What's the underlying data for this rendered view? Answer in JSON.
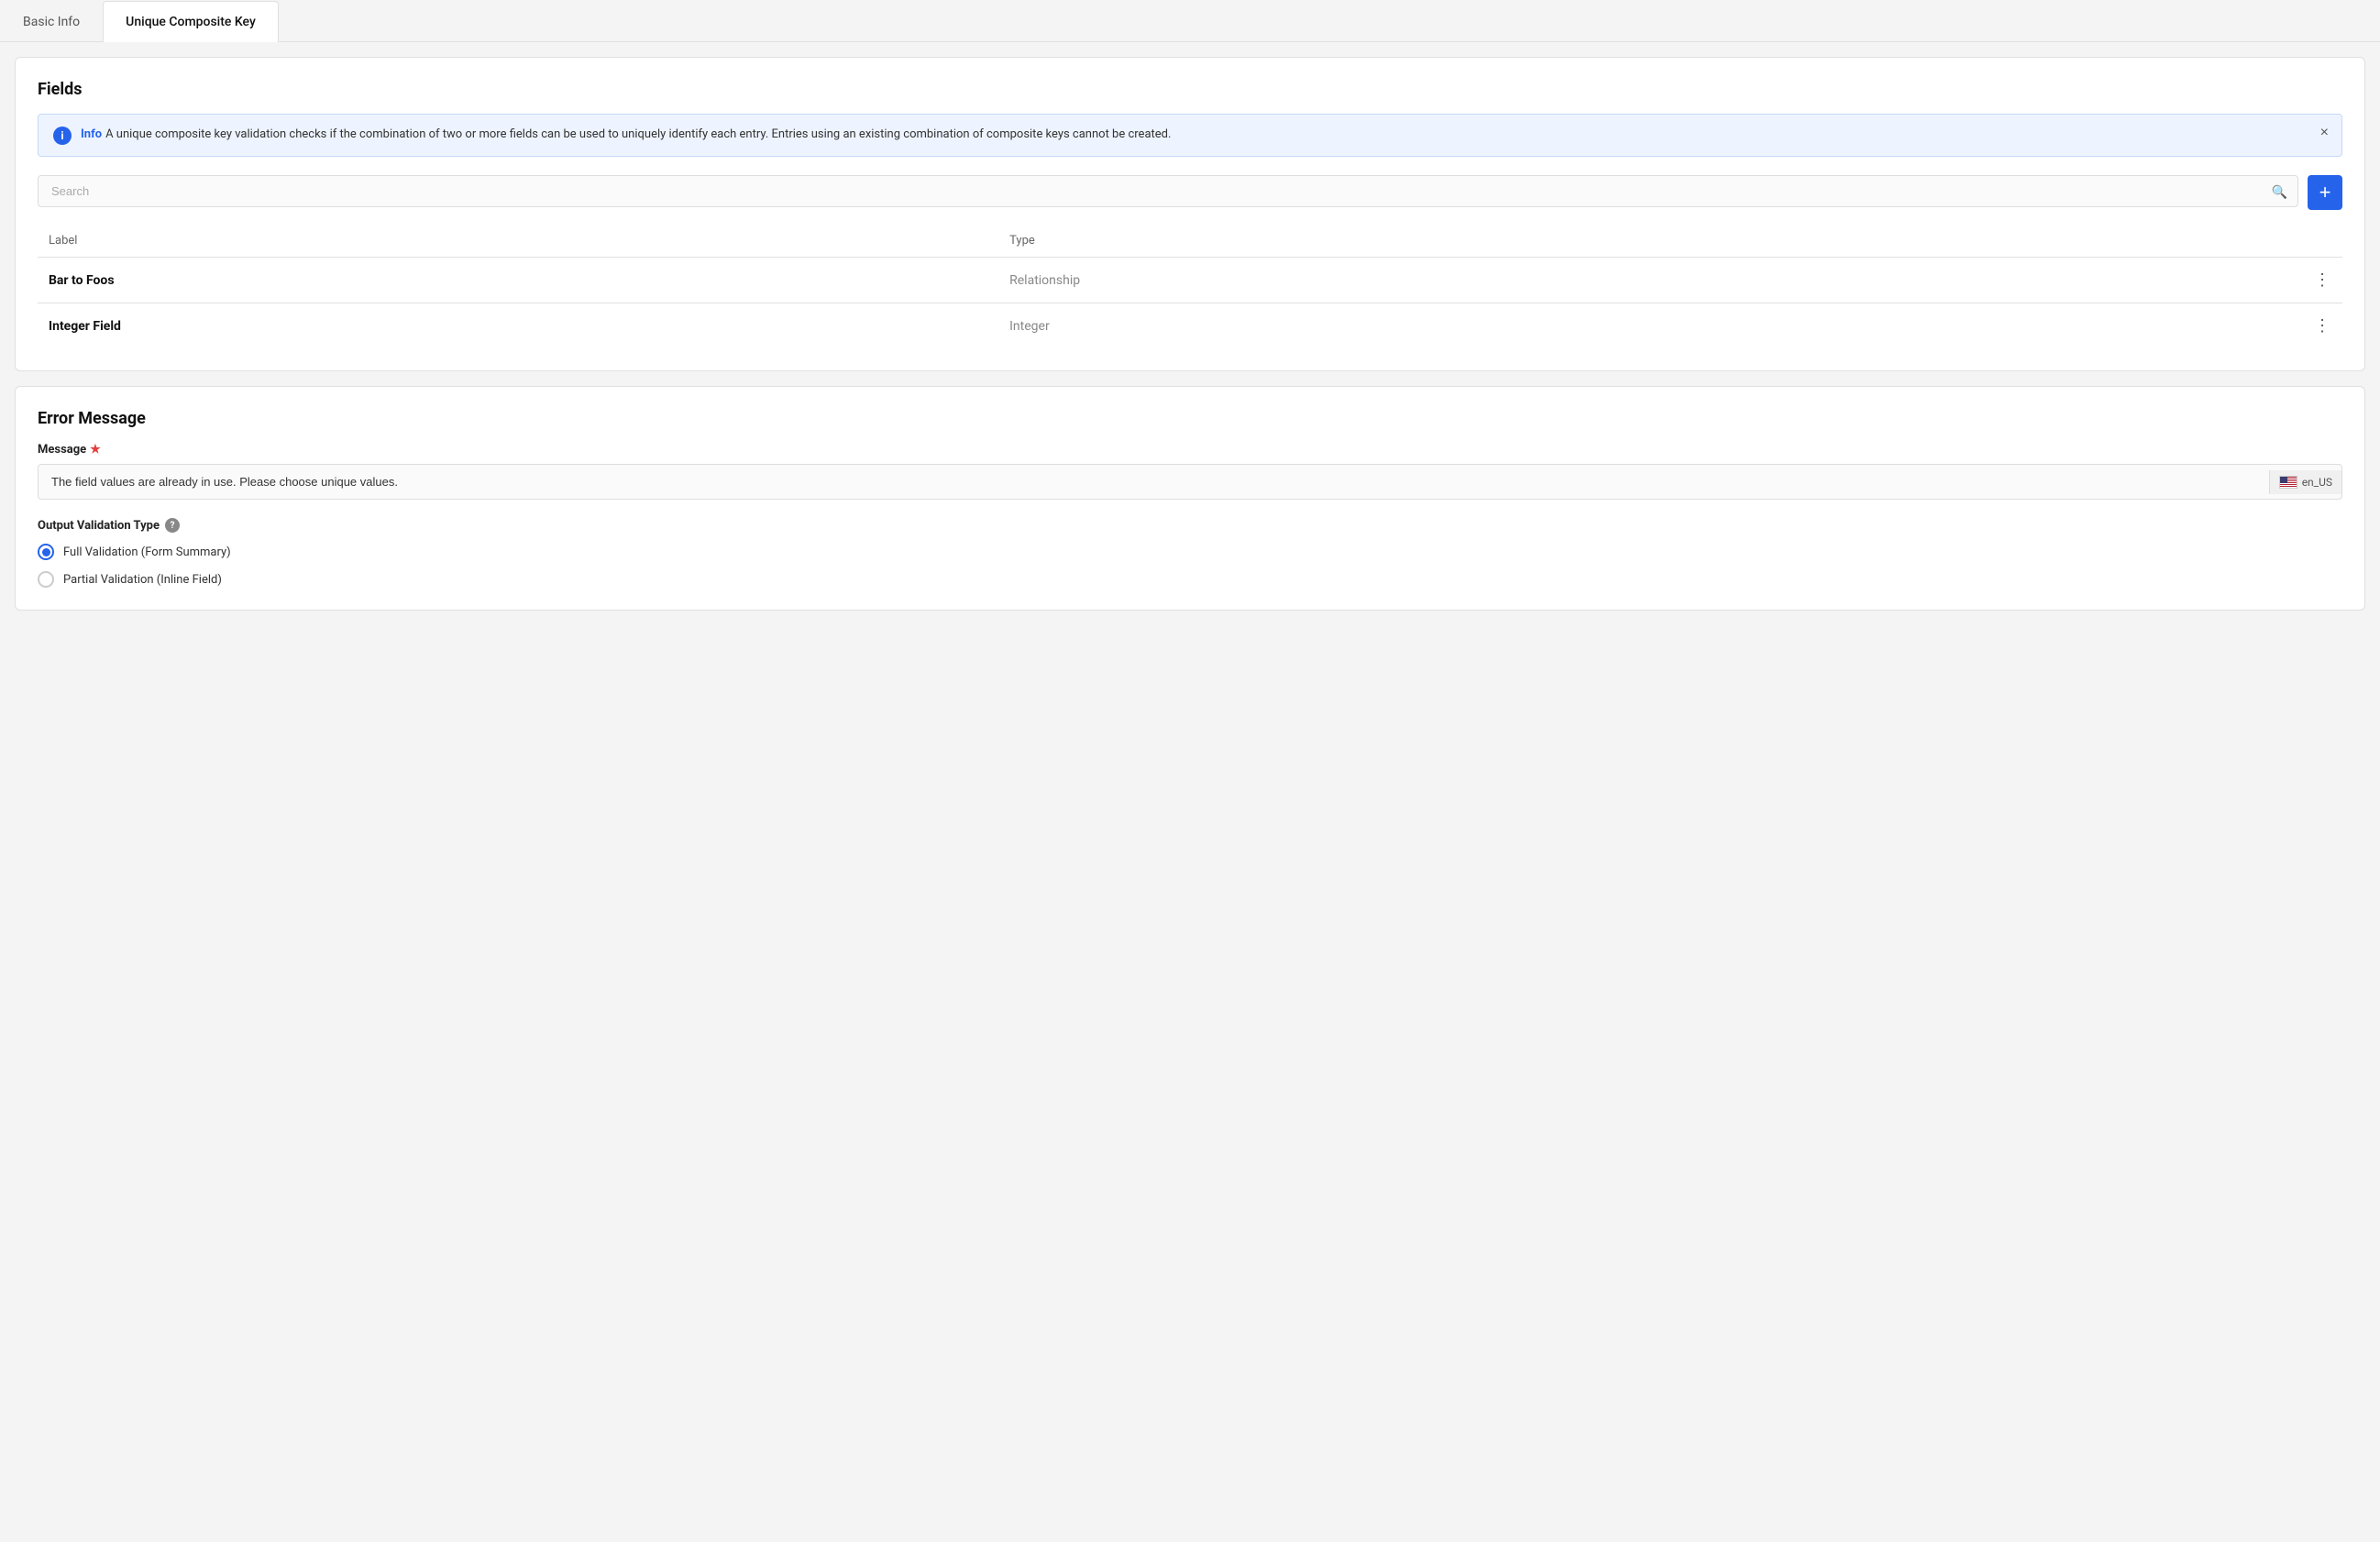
{
  "tabs": [
    {
      "id": "basic-info",
      "label": "Basic Info",
      "active": false
    },
    {
      "id": "unique-composite-key",
      "label": "Unique Composite Key",
      "active": true
    }
  ],
  "fields_section": {
    "title": "Fields",
    "info_banner": {
      "label": "Info",
      "text": "A unique composite key validation checks if the combination of two or more fields can be used to uniquely identify each entry. Entries using an existing combination of composite keys cannot be created."
    },
    "search": {
      "placeholder": "Search"
    },
    "add_button_label": "+",
    "table": {
      "headers": [
        "Label",
        "Type"
      ],
      "rows": [
        {
          "name": "Bar to Foos",
          "type": "Relationship"
        },
        {
          "name": "Integer Field",
          "type": "Integer"
        }
      ]
    }
  },
  "error_message_section": {
    "title": "Error Message",
    "message_label": "Message",
    "message_value": "The field values are already in use. Please choose unique values.",
    "locale_label": "en_US",
    "output_type_label": "Output Validation Type",
    "radio_options": [
      {
        "id": "full",
        "label": "Full Validation (Form Summary)",
        "selected": true
      },
      {
        "id": "partial",
        "label": "Partial Validation (Inline Field)",
        "selected": false
      }
    ]
  }
}
